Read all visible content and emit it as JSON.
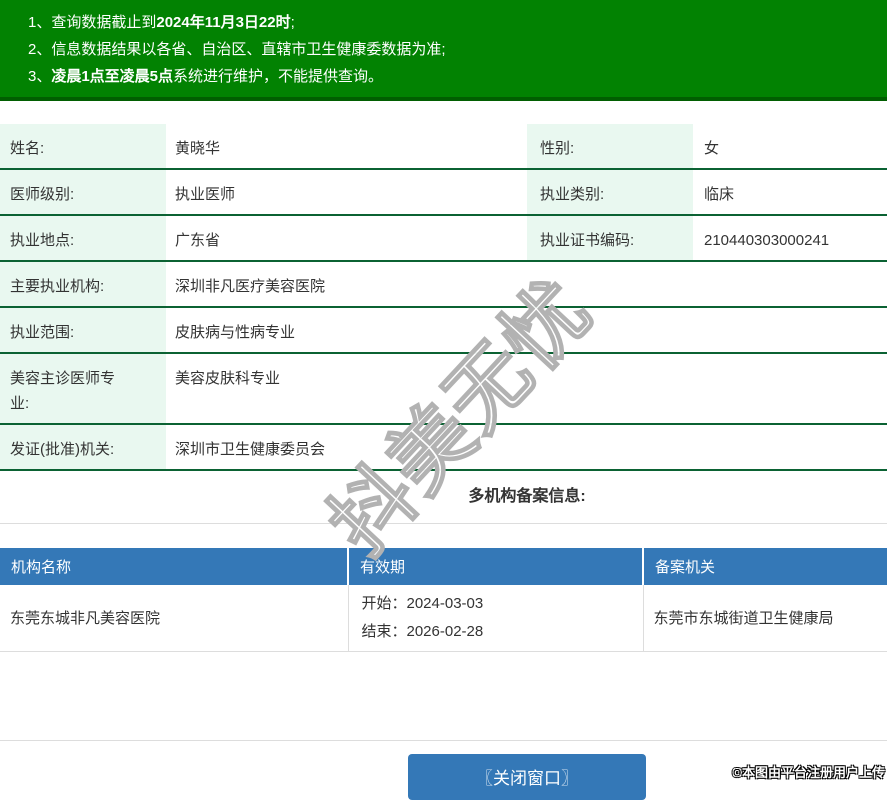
{
  "notice": {
    "lines": [
      {
        "num": "1、",
        "pre": "查询数据截止到",
        "bold": "2024年11月3日22时",
        "post": ";"
      },
      {
        "num": "2、",
        "pre": "信息数据结果以各省、自治区、直辖市卫生健康委数据为准;",
        "bold": "",
        "post": ""
      },
      {
        "num": "3、",
        "pre": "",
        "bold": "凌晨1点至凌晨5点",
        "post": "系统进行维护，不能提供查询。"
      }
    ]
  },
  "info": {
    "rows": [
      {
        "label1": "姓名:",
        "value1": "黄晓华",
        "label2": "性别:",
        "value2": "女"
      },
      {
        "label1": "医师级别:",
        "value1": "执业医师",
        "label2": "执业类别:",
        "value2": "临床"
      },
      {
        "label1": "执业地点:",
        "value1": "广东省",
        "label2": "执业证书编码:",
        "value2": "210440303000241"
      },
      {
        "label1": "主要执业机构:",
        "value1": "深圳非凡医疗美容医院"
      },
      {
        "label1": "执业范围:",
        "value1": "皮肤病与性病专业"
      },
      {
        "label1": "美容主诊医师专业:",
        "value1": "美容皮肤科专业"
      },
      {
        "label1": "发证(批准)机关:",
        "value1": "深圳市卫生健康委员会"
      }
    ]
  },
  "multi_org": {
    "heading": "多机构备案信息:",
    "columns": [
      "机构名称",
      "有效期",
      "备案机关"
    ],
    "rows": [
      {
        "name": "东莞东城非凡美容医院",
        "valid_start": "开始：2024-03-03",
        "valid_end": "结束：2026-02-28",
        "authority": "东莞市东城街道卫生健康局"
      }
    ]
  },
  "close_button": {
    "label": "〖关闭窗口〗"
  },
  "watermark": {
    "text": "抖美无忧"
  },
  "footer": {
    "copyright": "©本图由平台注册用户上传"
  },
  "colors": {
    "notice_green": "#028202",
    "notice_border_green": "#015e01",
    "row_border_green": "#0b6233",
    "label_bg_mint": "#e9f8f0",
    "table_header_blue": "#3478b7",
    "button_blue": "#3478b7",
    "divider_gray": "#dddddd"
  }
}
